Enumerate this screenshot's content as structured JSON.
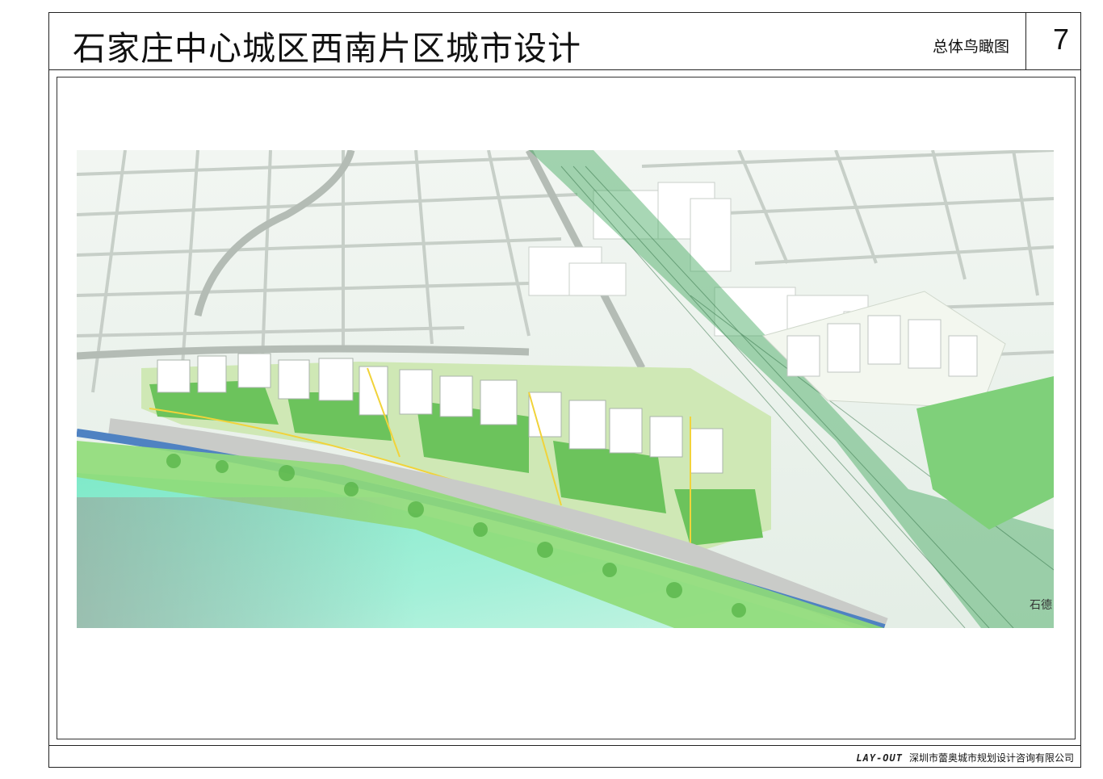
{
  "header": {
    "title": "石家庄中心城区西南片区城市设计",
    "subtitle": "总体鸟瞰图",
    "page_number": "7"
  },
  "image": {
    "label": "石德"
  },
  "footer": {
    "logo": "LAY-OUT",
    "company": "深圳市蕾奥城市规划设计咨询有限公司"
  }
}
